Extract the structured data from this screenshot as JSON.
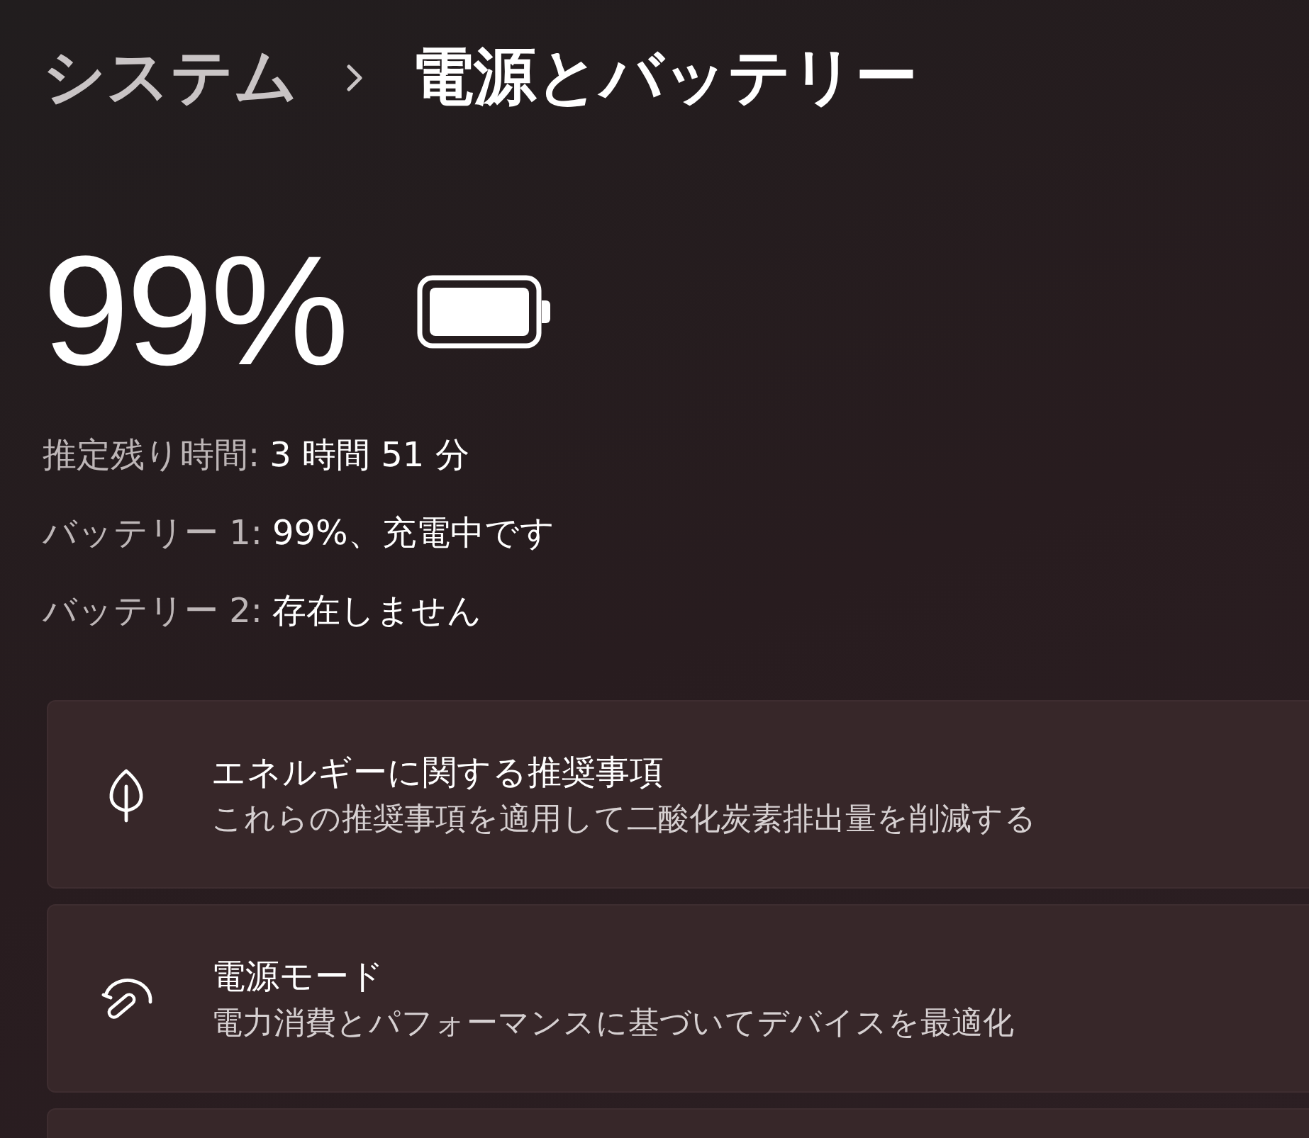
{
  "breadcrumb": {
    "parent": "システム",
    "current": "電源とバッテリー"
  },
  "battery": {
    "percent": "99%",
    "details": [
      {
        "label": "推定残り時間:",
        "value": "3 時間 51 分"
      },
      {
        "label": "バッテリー 1:",
        "value": "99%、充電中です"
      },
      {
        "label": "バッテリー 2:",
        "value": "存在しません"
      }
    ]
  },
  "settings": {
    "cards": [
      {
        "kind": "recommendations",
        "title": "エネルギーに関する推奨事項",
        "description": "これらの推奨事項を適用して二酸化炭素排出量を削減する"
      },
      {
        "kind": "mode",
        "title": "電源モード",
        "description": "電力消費とパフォーマンスに基づいてデバイスを最適化"
      }
    ],
    "more_below": true
  }
}
